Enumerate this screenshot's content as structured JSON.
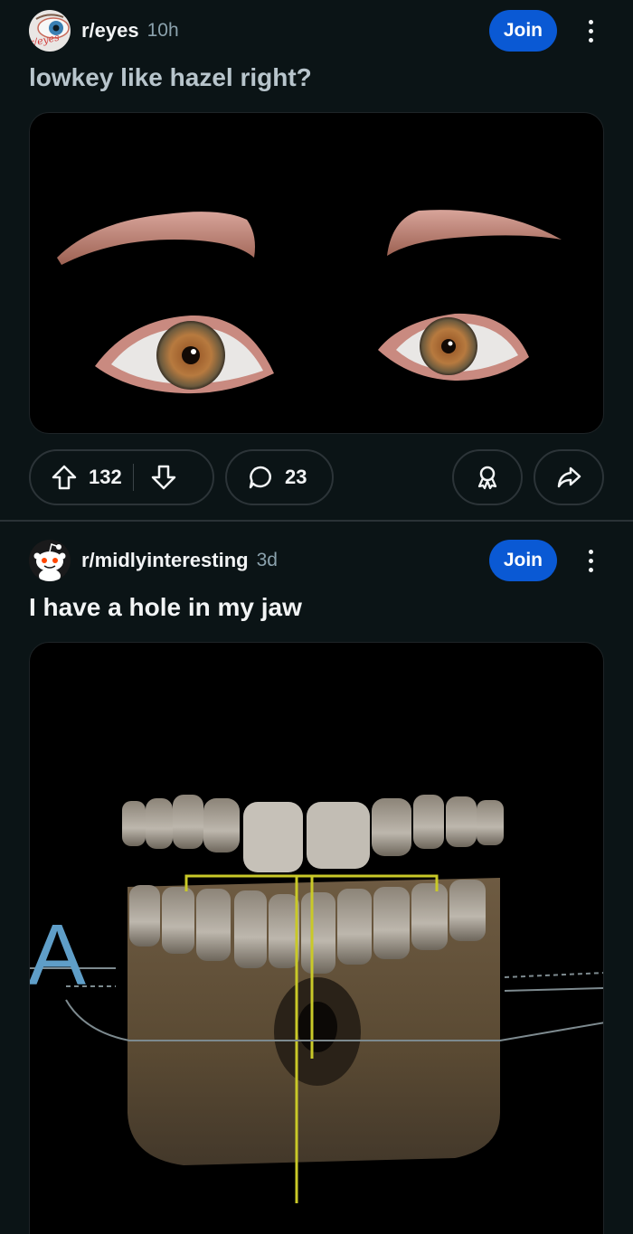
{
  "posts": [
    {
      "subreddit": "r/eyes",
      "avatar_icon": "eye-icon",
      "avatar_text": "r/eyes",
      "time": "10h",
      "join_label": "Join",
      "title": "lowkey like hazel right?",
      "image_alt": "digital render of hazel eyes and eyebrows on black background",
      "votes": "132",
      "comments": "23"
    },
    {
      "subreddit": "r/midlyinteresting",
      "avatar_icon": "snoo-icon",
      "time": "3d",
      "join_label": "Join",
      "title": "I have a hole in my jaw",
      "image_alt": "3D dental CT scan showing teeth and lower jaw with a hole",
      "scan_label": "A"
    }
  ],
  "colors": {
    "background": "#0b1416",
    "join_button": "#0a59d4",
    "muted_text": "#8ba2ad",
    "border": "#2c3438"
  }
}
